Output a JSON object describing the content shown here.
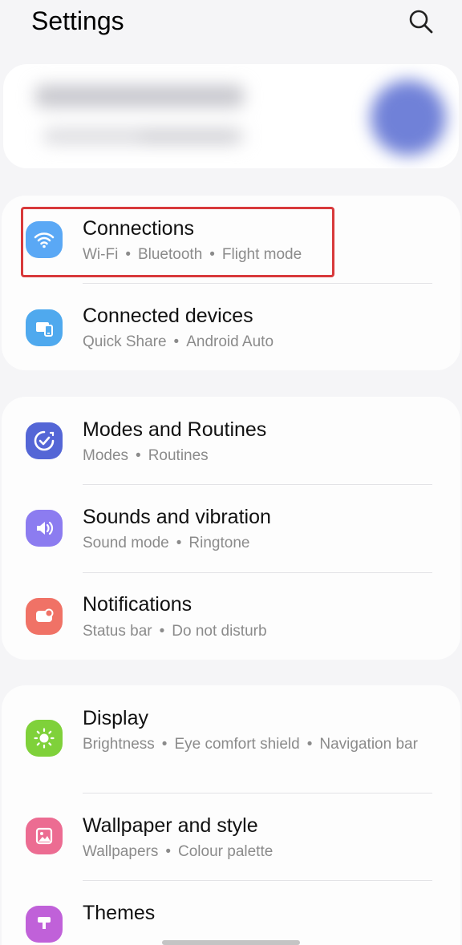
{
  "header": {
    "title": "Settings",
    "search_icon": "search-icon"
  },
  "groups": [
    {
      "items": [
        {
          "label": "Connections",
          "sub": [
            "Wi-Fi",
            "Bluetooth",
            "Flight mode"
          ],
          "icon": "wifi-icon",
          "color": "#5aa8f5"
        },
        {
          "label": "Connected devices",
          "sub": [
            "Quick Share",
            "Android Auto"
          ],
          "icon": "connected-devices-icon",
          "color": "#4fa9ee"
        }
      ]
    },
    {
      "items": [
        {
          "label": "Modes and Routines",
          "sub": [
            "Modes",
            "Routines"
          ],
          "icon": "modes-check-icon",
          "color": "#5466d6"
        },
        {
          "label": "Sounds and vibration",
          "sub": [
            "Sound mode",
            "Ringtone"
          ],
          "icon": "speaker-icon",
          "color": "#8c7cf0"
        },
        {
          "label": "Notifications",
          "sub": [
            "Status bar",
            "Do not disturb"
          ],
          "icon": "notification-icon",
          "color": "#f07266"
        }
      ]
    },
    {
      "items": [
        {
          "label": "Display",
          "sub": [
            "Brightness",
            "Eye comfort shield",
            "Navigation bar"
          ],
          "icon": "brightness-icon",
          "color": "#7fd13a"
        },
        {
          "label": "Wallpaper and style",
          "sub": [
            "Wallpapers",
            "Colour palette"
          ],
          "icon": "wallpaper-icon",
          "color": "#ec6c92"
        },
        {
          "label": "Themes",
          "sub": [],
          "icon": "themes-icon",
          "color": "#c061d9"
        }
      ]
    }
  ]
}
